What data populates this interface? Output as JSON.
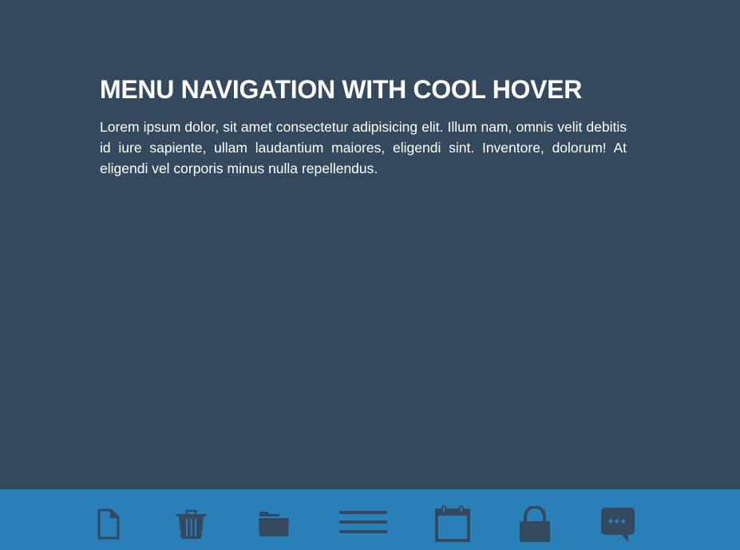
{
  "header": {
    "title": "MENU NAVIGATION WITH COOL HOVER"
  },
  "intro": {
    "text": "Lorem ipsum dolor, sit amet consectetur adipisicing elit. Illum nam, omnis velit debitis id iure sapiente, ullam laudantium maiores, eligendi sint. Inventore, dolorum! At eligendi vel corporis minus nulla repellendus."
  },
  "nav": {
    "items": [
      {
        "icon": "file-icon"
      },
      {
        "icon": "trash-icon"
      },
      {
        "icon": "folder-icon"
      },
      {
        "icon": "menu-icon"
      },
      {
        "icon": "calendar-icon"
      },
      {
        "icon": "lock-icon"
      },
      {
        "icon": "chat-icon"
      }
    ]
  },
  "colors": {
    "background": "#34495e",
    "nav_bar": "#2980b9",
    "icon": "#34495e",
    "text": "#ffffff"
  }
}
